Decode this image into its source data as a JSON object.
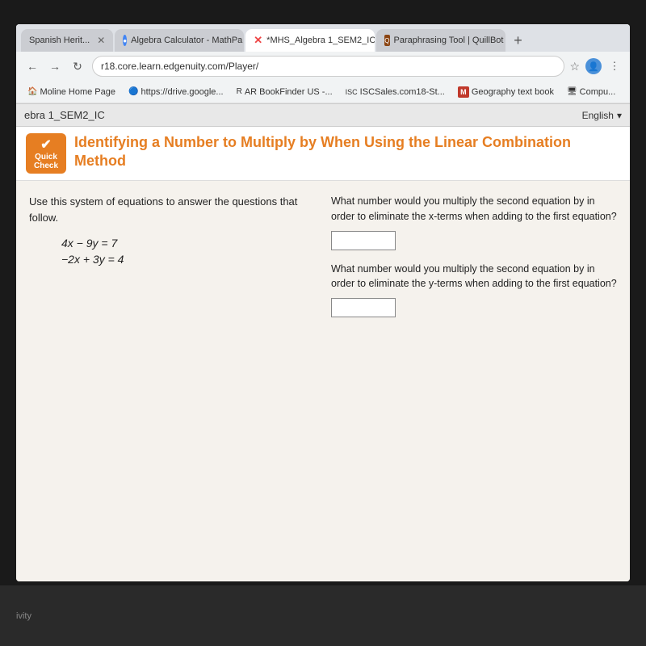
{
  "browser": {
    "tabs": [
      {
        "label": "Spanish Herit...",
        "active": false,
        "favicon": "text",
        "favicon_text": "S"
      },
      {
        "label": "Algebra Calculator - MathPa",
        "active": false,
        "favicon": "circle",
        "favicon_text": "●"
      },
      {
        "label": "*MHS_Algebra 1_SEM2_IC -",
        "active": true,
        "favicon": "x",
        "favicon_text": "✕"
      },
      {
        "label": "Paraphrasing Tool | QuillBot",
        "active": false,
        "favicon": "quill",
        "favicon_text": "Q"
      },
      {
        "label": "+",
        "active": false,
        "favicon": "",
        "favicon_text": "+"
      }
    ],
    "url": "r18.core.learn.edgenuity.com/Player/",
    "bookmarks": [
      {
        "label": "Moline Home Page",
        "icon": "🏠"
      },
      {
        "label": "https://drive.google...",
        "icon": "🔵"
      },
      {
        "label": "AR BookFinder US -...",
        "icon": "R"
      },
      {
        "label": "ISCSales.com18-St...",
        "icon": "ISC"
      },
      {
        "label": "Geography text book",
        "icon": "M"
      },
      {
        "label": "Compu...",
        "icon": "🖥"
      }
    ]
  },
  "site": {
    "header_label": "ebra 1_SEM2_IC",
    "language": "English",
    "language_dropdown": "▾"
  },
  "lesson": {
    "badge_line1": "Quick",
    "badge_line2": "Check",
    "title": "Identifying a Number to Multiply by When Using the Linear Combination Method"
  },
  "main": {
    "intro": "Use this system of equations to answer the questions that follow.",
    "eq1": "4x − 9y = 7",
    "eq2": "−2x + 3y = 4",
    "question1": "What number would you multiply the second equation by in order to eliminate the x-terms when adding to the first equation?",
    "question2": "What number would you multiply the second equation by in order to eliminate the y-terms when adding to the first equation?"
  },
  "taskbar": {
    "label": "ivity"
  }
}
